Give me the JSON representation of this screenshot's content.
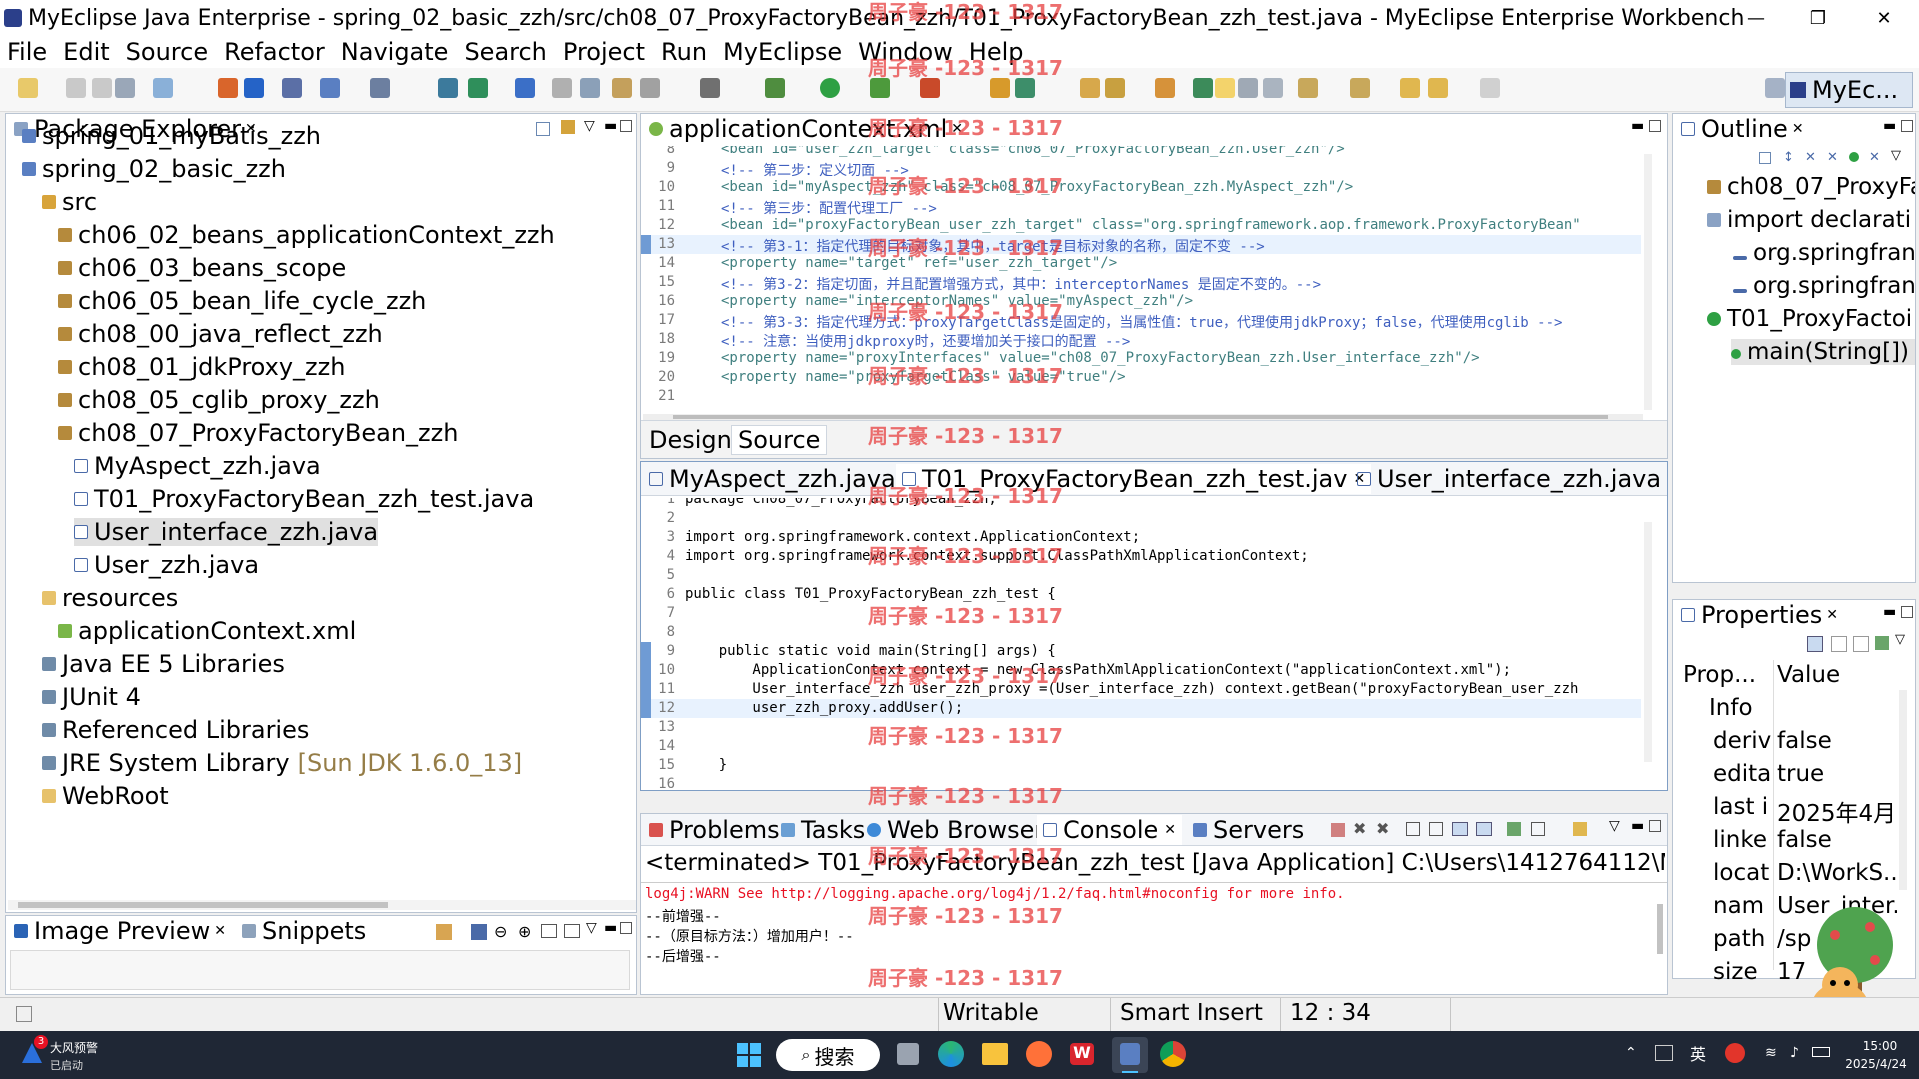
{
  "window": {
    "title": "MyEclipse Java Enterprise - spring_02_basic_zzh/src/ch08_07_ProxyFactoryBean_zzh/T01_ProxyFactoryBean_zzh_test.java - MyEclipse Enterprise Workbench"
  },
  "menu": [
    "File",
    "Edit",
    "Source",
    "Refactor",
    "Navigate",
    "Search",
    "Project",
    "Run",
    "MyEclipse",
    "Window",
    "Help"
  ],
  "perspective": {
    "label": "MyEc..."
  },
  "package_explorer": {
    "tab": "Package Explorer",
    "items": [
      {
        "label": "spring_01_myBatis_zzh",
        "icon": "project-icon"
      },
      {
        "label": "spring_02_basic_zzh",
        "icon": "project-icon"
      },
      {
        "label": "src",
        "icon": "source-folder-icon"
      },
      {
        "label": "ch06_02_beans_applicationContext_zzh",
        "icon": "package-icon"
      },
      {
        "label": "ch06_03_beans_scope",
        "icon": "package-icon"
      },
      {
        "label": "ch06_05_bean_life_cycle_zzh",
        "icon": "package-icon"
      },
      {
        "label": "ch08_00_java_reflect_zzh",
        "icon": "package-icon"
      },
      {
        "label": "ch08_01_jdkProxy_zzh",
        "icon": "package-icon"
      },
      {
        "label": "ch08_05_cglib_proxy_zzh",
        "icon": "package-icon"
      },
      {
        "label": "ch08_07_ProxyFactoryBean_zzh",
        "icon": "package-icon"
      },
      {
        "label": "MyAspect_zzh.java",
        "icon": "java-file-icon"
      },
      {
        "label": "T01_ProxyFactoryBean_zzh_test.java",
        "icon": "java-file-icon"
      },
      {
        "label": "User_interface_zzh.java",
        "icon": "java-file-icon"
      },
      {
        "label": "User_zzh.java",
        "icon": "java-file-icon"
      },
      {
        "label": "resources",
        "icon": "folder-icon"
      },
      {
        "label": "applicationContext.xml",
        "icon": "xml-file-icon"
      },
      {
        "label": "Java EE 5 Libraries",
        "icon": "library-icon"
      },
      {
        "label": "JUnit 4",
        "icon": "library-icon"
      },
      {
        "label": "Referenced Libraries",
        "icon": "library-icon"
      },
      {
        "label": "JRE System Library",
        "icon": "library-icon"
      },
      {
        "label": "WebRoot",
        "icon": "folder-icon"
      }
    ],
    "jre_suffix": "[Sun JDK 1.6.0_13]"
  },
  "image_preview": {
    "tab": "Image Preview",
    "tab2": "Snippets"
  },
  "xml_editor": {
    "tab": "applicationContext.xml",
    "design_tab": "Design",
    "source_tab": "Source",
    "lines": [
      {
        "n": "8",
        "html": "&lt;bean id=\"user_zzh_target\" class=\"ch08_07_ProxyFactoryBean_zzh.User_zzh\"/&gt;"
      },
      {
        "n": "9",
        "text": "<!-- 第二步：定义切面 -->"
      },
      {
        "n": "10",
        "text": "<bean id=\"myAspect_zzh\" class=\"ch08_07_ProxyFactoryBean_zzh.MyAspect_zzh\"/>"
      },
      {
        "n": "11",
        "text": "<!-- 第三步：配置代理工厂 -->"
      },
      {
        "n": "12",
        "text": "<bean id=\"proxyFactoryBean_user_zzh_target\" class=\"org.springframework.aop.framework.ProxyFactoryBean\""
      },
      {
        "n": "13",
        "text": "<!-- 第3-1：指定代理的目标对象，其中，target是目标对象的名称，固定不变 -->"
      },
      {
        "n": "14",
        "text": "<property name=\"target\" ref=\"user_zzh_target\"/>"
      },
      {
        "n": "15",
        "text": "<!-- 第3-2：指定切面，并且配置增强方式，其中：interceptorNames 是固定不变的。-->"
      },
      {
        "n": "16",
        "text": "<property name=\"interceptorNames\" value=\"myAspect_zzh\"/>"
      },
      {
        "n": "17",
        "text": "<!-- 第3-3：指定代理方式：proxyTargetClass是固定的，当属性值：true，代理使用jdkProxy；false，代理使用cglib -->"
      },
      {
        "n": "18",
        "text": "<!-- 注意：当使用jdkproxy时，还要增加关于接口的配置 -->"
      },
      {
        "n": "19",
        "text": "<property name=\"proxyInterfaces\" value=\"ch08_07_ProxyFactoryBean_zzh.User_interface_zzh\"/>"
      },
      {
        "n": "20",
        "text": "<property name=\"proxyTargetClass\" value=\"true\"/>"
      },
      {
        "n": "21",
        "text": ""
      }
    ]
  },
  "java_editor": {
    "tabs": [
      "MyAspect_zzh.java",
      "T01_ProxyFactoryBean_zzh_test.jav",
      "User_interface_zzh.java"
    ],
    "lines": [
      {
        "n": "1",
        "text": "package ch08_07_ProxyFactoryBean_zzh;"
      },
      {
        "n": "2",
        "text": ""
      },
      {
        "n": "3",
        "text": "import org.springframework.context.ApplicationContext;"
      },
      {
        "n": "4",
        "text": "import org.springframework.context.support.ClassPathXmlApplicationContext;"
      },
      {
        "n": "5",
        "text": ""
      },
      {
        "n": "6",
        "text": "public class T01_ProxyFactoryBean_zzh_test {"
      },
      {
        "n": "7",
        "text": ""
      },
      {
        "n": "8",
        "text": ""
      },
      {
        "n": "9",
        "text": "    public static void main(String[] args) {"
      },
      {
        "n": "10",
        "text": "        ApplicationContext context = new ClassPathXmlApplicationContext(\"applicationContext.xml\");"
      },
      {
        "n": "11",
        "text": "        User_interface_zzh user_zzh_proxy =(User_interface_zzh) context.getBean(\"proxyFactoryBean_user_zzh"
      },
      {
        "n": "12",
        "text": "        user_zzh_proxy.addUser();"
      },
      {
        "n": "13",
        "text": ""
      },
      {
        "n": "14",
        "text": ""
      },
      {
        "n": "15",
        "text": "    }"
      },
      {
        "n": "16",
        "text": ""
      }
    ]
  },
  "console": {
    "tabs": [
      "Problems",
      "Tasks",
      "Web Browser",
      "Console",
      "Servers"
    ],
    "header": "<terminated> T01_ProxyFactoryBean_zzh_test [Java Application] C:\\Users\\1412764112\\MyEcl",
    "lines": [
      {
        "text": "log4j:WARN See http://logging.apache.org/log4j/1.2/faq.html#noconfig for more info.",
        "color": "#e81123"
      },
      {
        "text": "--前增强--",
        "color": "#000000"
      },
      {
        "text": "--（原目标方法：）增加用户！--",
        "color": "#000000"
      },
      {
        "text": "--后增强--",
        "color": "#000000"
      }
    ]
  },
  "outline": {
    "tab": "Outline",
    "items": [
      {
        "label": "ch08_07_ProxyFa"
      },
      {
        "label": "import declarati"
      },
      {
        "label": "org.springfran"
      },
      {
        "label": "org.springfran"
      },
      {
        "label": "T01_ProxyFactoi"
      },
      {
        "label": "main(String[])"
      }
    ]
  },
  "properties": {
    "tab": "Properties",
    "col1": "Prop...",
    "col2": "Value",
    "group": "Info",
    "rows": [
      {
        "k": "deriv",
        "v": "false"
      },
      {
        "k": "edita",
        "v": "true"
      },
      {
        "k": "last i",
        "v": "2025年4月.."
      },
      {
        "k": "linke",
        "v": "false"
      },
      {
        "k": "locat",
        "v": "D:\\WorkS.."
      },
      {
        "k": "nam",
        "v": "User_inter.."
      },
      {
        "k": "path",
        "v": "/sp"
      },
      {
        "k": "size",
        "v": "17"
      }
    ]
  },
  "status": {
    "writable": "Writable",
    "insert": "Smart Insert",
    "position": "12 : 34"
  },
  "taskbar": {
    "weather_title": "大风预警",
    "weather_sub": "已启动",
    "badge": "3",
    "search": "搜索",
    "ime": "英",
    "time": "15:00",
    "date": "2025/4/24"
  },
  "watermark": "周子豪 -123 - 1317"
}
